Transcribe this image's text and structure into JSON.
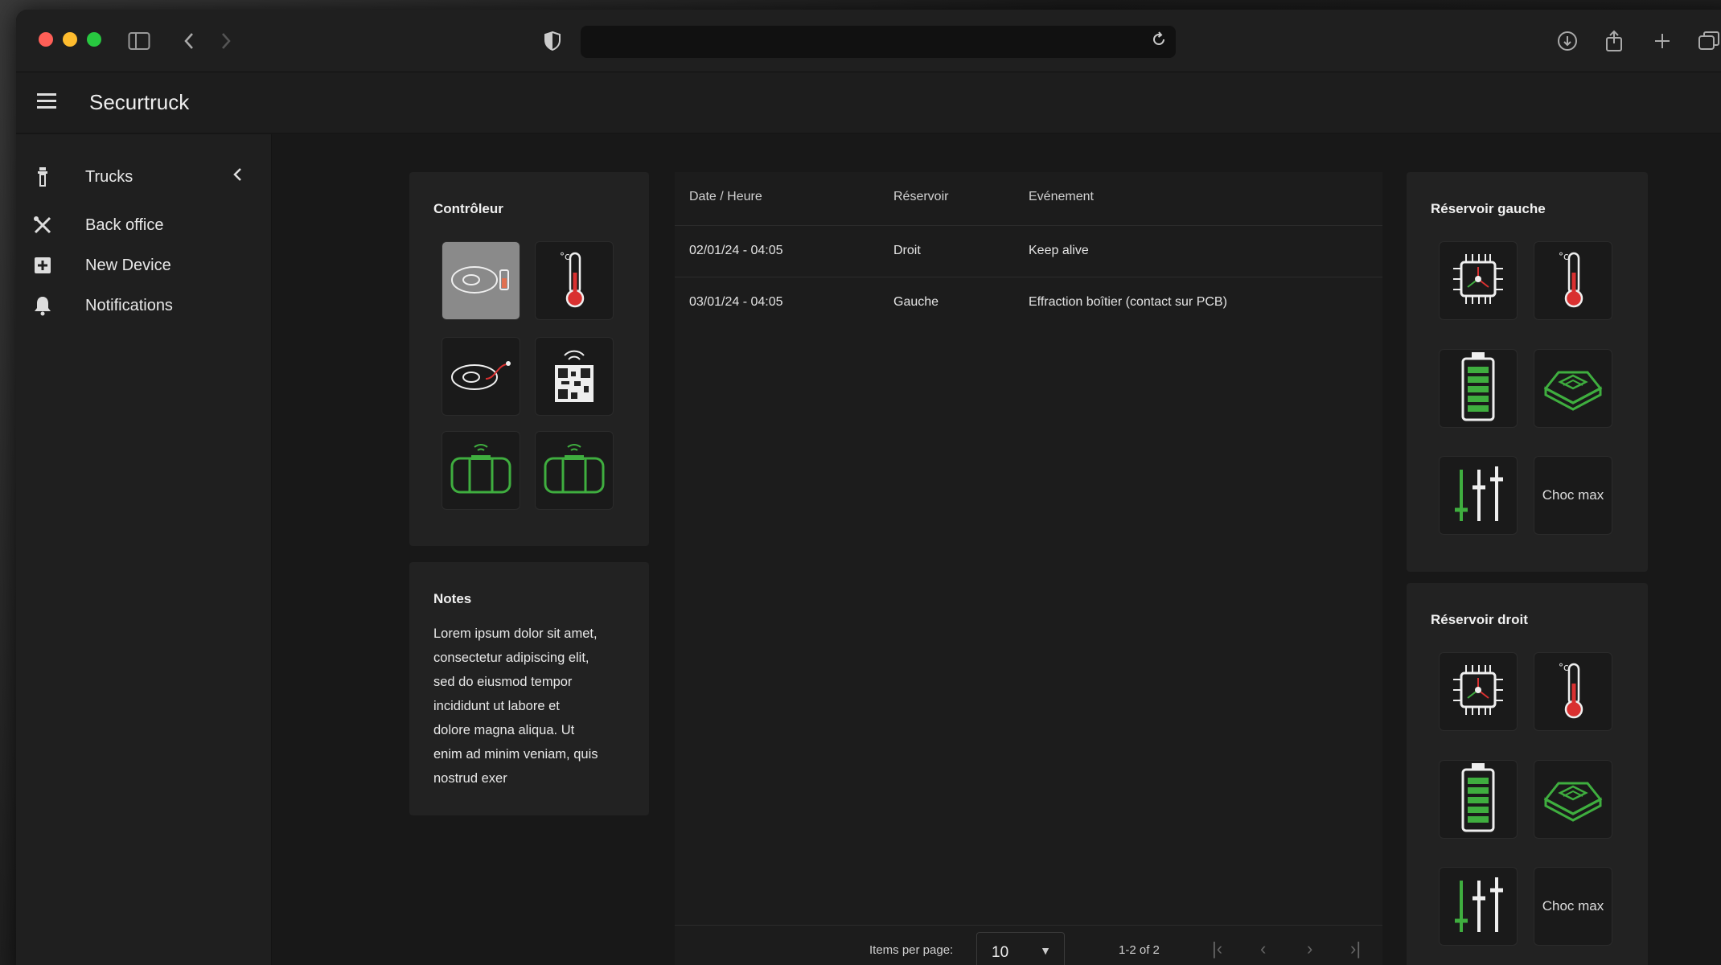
{
  "browser": {
    "icons": [
      "sidebar-icon",
      "back-icon",
      "forward-icon",
      "shield-icon",
      "reload-icon",
      "download-icon",
      "share-icon",
      "new-tab-icon",
      "tabs-icon"
    ]
  },
  "app": {
    "title": "Securtruck"
  },
  "sidebar": {
    "items": [
      {
        "label": "Trucks",
        "icon": "truck-icon"
      },
      {
        "label": "Back office",
        "icon": "tools-icon"
      },
      {
        "label": "New Device",
        "icon": "add-box-icon"
      },
      {
        "label": "Notifications",
        "icon": "bell-icon"
      }
    ]
  },
  "controller": {
    "title": "Contrôleur",
    "tiles": [
      "seal-battery-icon",
      "thermometer-icon",
      "seal-cable-icon",
      "qr-wifi-icon",
      "tank-wifi-icon",
      "tank-wifi-icon"
    ]
  },
  "notes": {
    "title": "Notes",
    "lines": [
      "Lorem ipsum dolor sit amet,",
      "consectetur adipiscing elit,",
      "sed do eiusmod tempor",
      "incididunt ut labore et",
      "dolore magna aliqua. Ut",
      "enim ad minim veniam, quis",
      "nostrud exer"
    ]
  },
  "table": {
    "headers": [
      "Date / Heure",
      "Réservoir",
      "Evénement"
    ],
    "rows": [
      [
        "02/01/24 - 04:05",
        "Droit",
        "Keep alive"
      ],
      [
        "03/01/24 - 04:05",
        "Gauche",
        "Effraction boîtier (contact sur PCB)"
      ]
    ],
    "items_per_page_label": "Items per page:",
    "items_per_page_value": "10",
    "range": "1-2 of 2"
  },
  "tank_left": {
    "title": "Réservoir gauche",
    "choc_label": "Choc max"
  },
  "tank_right": {
    "title": "Réservoir droit",
    "choc_label": "Choc max"
  },
  "colors": {
    "accent_green": "#3fae3f",
    "thermo_red": "#d93030"
  }
}
